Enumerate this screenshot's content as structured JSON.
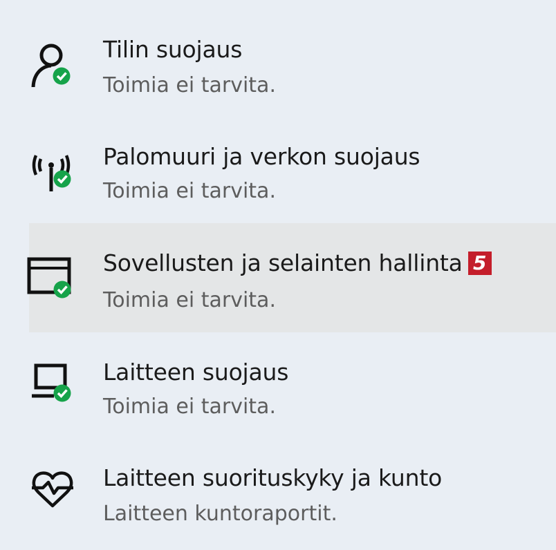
{
  "items": [
    {
      "title": "Tilin suojaus",
      "subtitle": "Toimia ei tarvita.",
      "icon": "account-protection-icon",
      "status": "ok"
    },
    {
      "title": "Palomuuri ja verkon suojaus",
      "subtitle": "Toimia ei tarvita.",
      "icon": "firewall-network-icon",
      "status": "ok"
    },
    {
      "title": "Sovellusten ja selainten hallinta",
      "subtitle": "Toimia ei tarvita.",
      "icon": "app-browser-control-icon",
      "status": "ok",
      "selected": true,
      "badge": "5"
    },
    {
      "title": "Laitteen suojaus",
      "subtitle": "Toimia ei tarvita.",
      "icon": "device-security-icon",
      "status": "ok"
    },
    {
      "title": "Laitteen suorituskyky ja kunto",
      "subtitle": "Laitteen kuntoraportit.",
      "icon": "device-health-icon",
      "status": "none"
    }
  ],
  "colors": {
    "background": "#e9eef4",
    "selected_background": "#e4e6e7",
    "status_ok": "#16a34a",
    "badge": "#c41e2b"
  }
}
